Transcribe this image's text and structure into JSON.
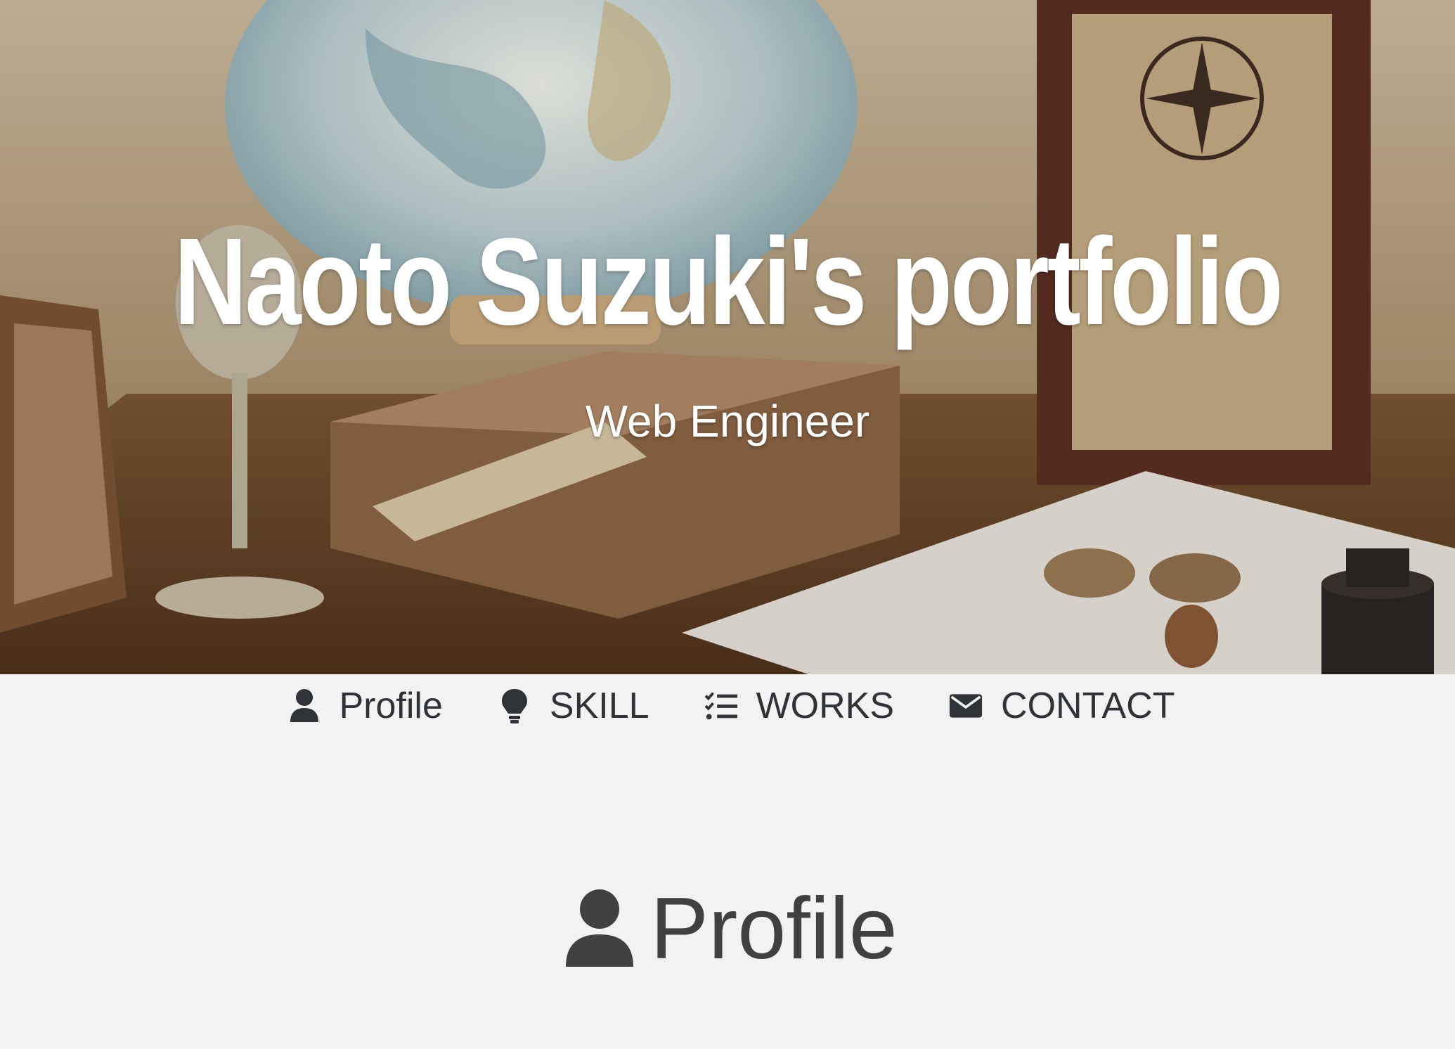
{
  "hero": {
    "title": "Naoto Suzuki's portfolio",
    "subtitle": "Web Engineer"
  },
  "nav": {
    "items": [
      {
        "label": "Profile",
        "icon": "user-icon"
      },
      {
        "label": "SKILL",
        "icon": "lightbulb-icon"
      },
      {
        "label": "WORKS",
        "icon": "tasks-icon"
      },
      {
        "label": "CONTACT",
        "icon": "envelope-icon"
      }
    ]
  },
  "section": {
    "title": "Profile",
    "icon": "user-icon"
  },
  "colors": {
    "background": "#f2f2f2",
    "nav_text": "#2f3338",
    "section_title": "#404040",
    "hero_text": "#ffffff"
  }
}
